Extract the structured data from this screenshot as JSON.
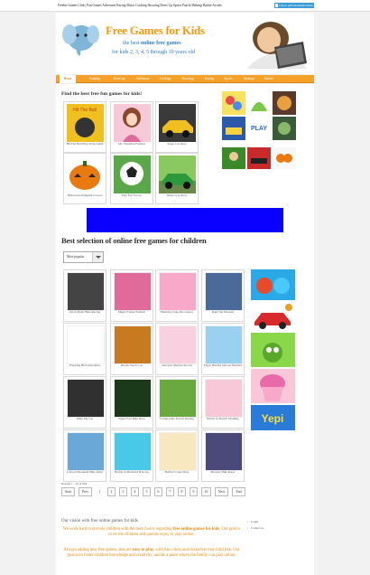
{
  "topbar": {
    "categories": "Freebie Games Club | Fun Games Adventure Racing Music Cooking Shooting Dress Up Sports Puzzle Makeup Barbie Arcade",
    "fb_label": "Follow @FreeGamesForKids"
  },
  "header": {
    "title": "Free Games for Kids",
    "sub1_prefix": "the best",
    "sub1_bold": "online free games",
    "sub2": "for kids 2, 3, 4, 5 through 10 years old"
  },
  "nav": [
    {
      "label": "Home",
      "active": true
    },
    {
      "label": "Painting",
      "active": false
    },
    {
      "label": "Dress up",
      "active": false
    },
    {
      "label": "Adventure",
      "active": false
    },
    {
      "label": "Cooking",
      "active": false
    },
    {
      "label": "Shooting",
      "active": false
    },
    {
      "label": "Racing",
      "active": false
    },
    {
      "label": "Sports",
      "active": false
    },
    {
      "label": "Makeup",
      "active": false
    },
    {
      "label": "Barbie",
      "active": false
    }
  ],
  "featured": {
    "heading": "Find the best free fun games for kids!",
    "tiles": [
      {
        "caption": "Hit The Ball Ping Pong Game",
        "color": "#f0c020"
      },
      {
        "caption": "My Valentine Fashion",
        "color": "#f6c8d8"
      },
      {
        "caption": "Super Car Race",
        "color": "#3a3a3a"
      },
      {
        "caption": "Halloween Pumpkin Creator",
        "color": "#c84a10"
      },
      {
        "caption": "Play Fun Soccer",
        "color": "#2e7a2e"
      },
      {
        "caption": "Desert Car Race",
        "color": "#6aa840"
      }
    ]
  },
  "ad": {
    "color": "#0a00ff"
  },
  "selection": {
    "heading": "Best selection of online free games for children",
    "select_value": "Most popular",
    "games": [
      {
        "caption": "Ghost Rider Bike Racing",
        "color": "#444444"
      },
      {
        "caption": "Magic Fairies Fashion",
        "color": "#e06a9a"
      },
      {
        "caption": "Birthday Cake Decoration",
        "color": "#f8a8c8"
      },
      {
        "caption": "Ram The Monster",
        "color": "#4a6a9a"
      },
      {
        "caption": "Flapping Bird Adventure",
        "color": "#ffffff"
      },
      {
        "caption": "Dream Sports Car",
        "color": "#c87a20"
      },
      {
        "caption": "Decorate Barbie's Room",
        "color": "#f8d0e0"
      },
      {
        "caption": "Magic Bubble Shooter Bubbles",
        "color": "#9ad0f0"
      },
      {
        "caption": "Pimp My Car",
        "color": "#303030"
      },
      {
        "caption": "Super Fast Bike Race",
        "color": "#1a3a1a"
      },
      {
        "caption": "Countryside Tractor Racing",
        "color": "#6aa840"
      },
      {
        "caption": "Barbie in Dream Wedding",
        "color": "#f8c8d8"
      },
      {
        "caption": "Canyon Mountain Bike Rider",
        "color": "#6aa8d8"
      },
      {
        "caption": "Barbie in Mermaid Princess",
        "color": "#4ac8e8"
      },
      {
        "caption": "Barbie's Cake Shop",
        "color": "#f8e8c0"
      },
      {
        "caption": "Monster Bike Racer",
        "color": "#4a4a7a"
      }
    ],
    "results_text": "Results 1 - 16 of 964",
    "pager": [
      "Start",
      "Prev",
      "1",
      "2",
      "3",
      "4",
      "5",
      "6",
      "7",
      "8",
      "9",
      "10",
      "Next",
      "End"
    ]
  },
  "vision": {
    "title": "Our vision with free online games for kids",
    "p1_a": "We work hard to provide children with the best choice regarding",
    "p1_b": "free online games for kids",
    "p1_c": ". Our goal is to let the children and parents enjoy to play online.",
    "p2_a": "Always adding new free games, that are",
    "p2_b": "easy to play",
    "p2_c": ", with fun colors and characters that child like. Our goal is to foster children knowledge and creativity, and be a place where the family can play online."
  },
  "right_links": [
    "Login",
    "Contact us"
  ]
}
